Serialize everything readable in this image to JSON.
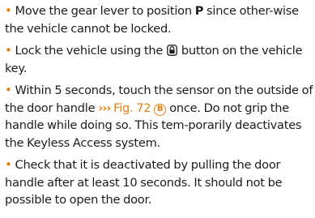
{
  "colors": {
    "accent": "#e87f0a",
    "text": "#1c1c1c"
  },
  "bullet_glyph": "•",
  "steps": [
    {
      "before": " Move the gear lever to position ",
      "key": "P",
      "after": " since other-wise the vehicle cannot be locked."
    },
    {
      "before": " Lock the vehicle using the ",
      "icon": "lock-button-icon",
      "after": " button on the vehicle key."
    },
    {
      "before": "  Within 5 seconds, touch the sensor on the outside of the door handle ",
      "ref_arrows": "›››",
      "ref_label": " Fig. 72 ",
      "ref_badge": "B",
      "after": " once. Do not grip the handle while doing so. This tem-porarily deactivates the Keyless Access system."
    },
    {
      "before": " Check that it is deactivated by pulling the door handle after at least 10 seconds. It should not be possible to open the door."
    }
  ]
}
